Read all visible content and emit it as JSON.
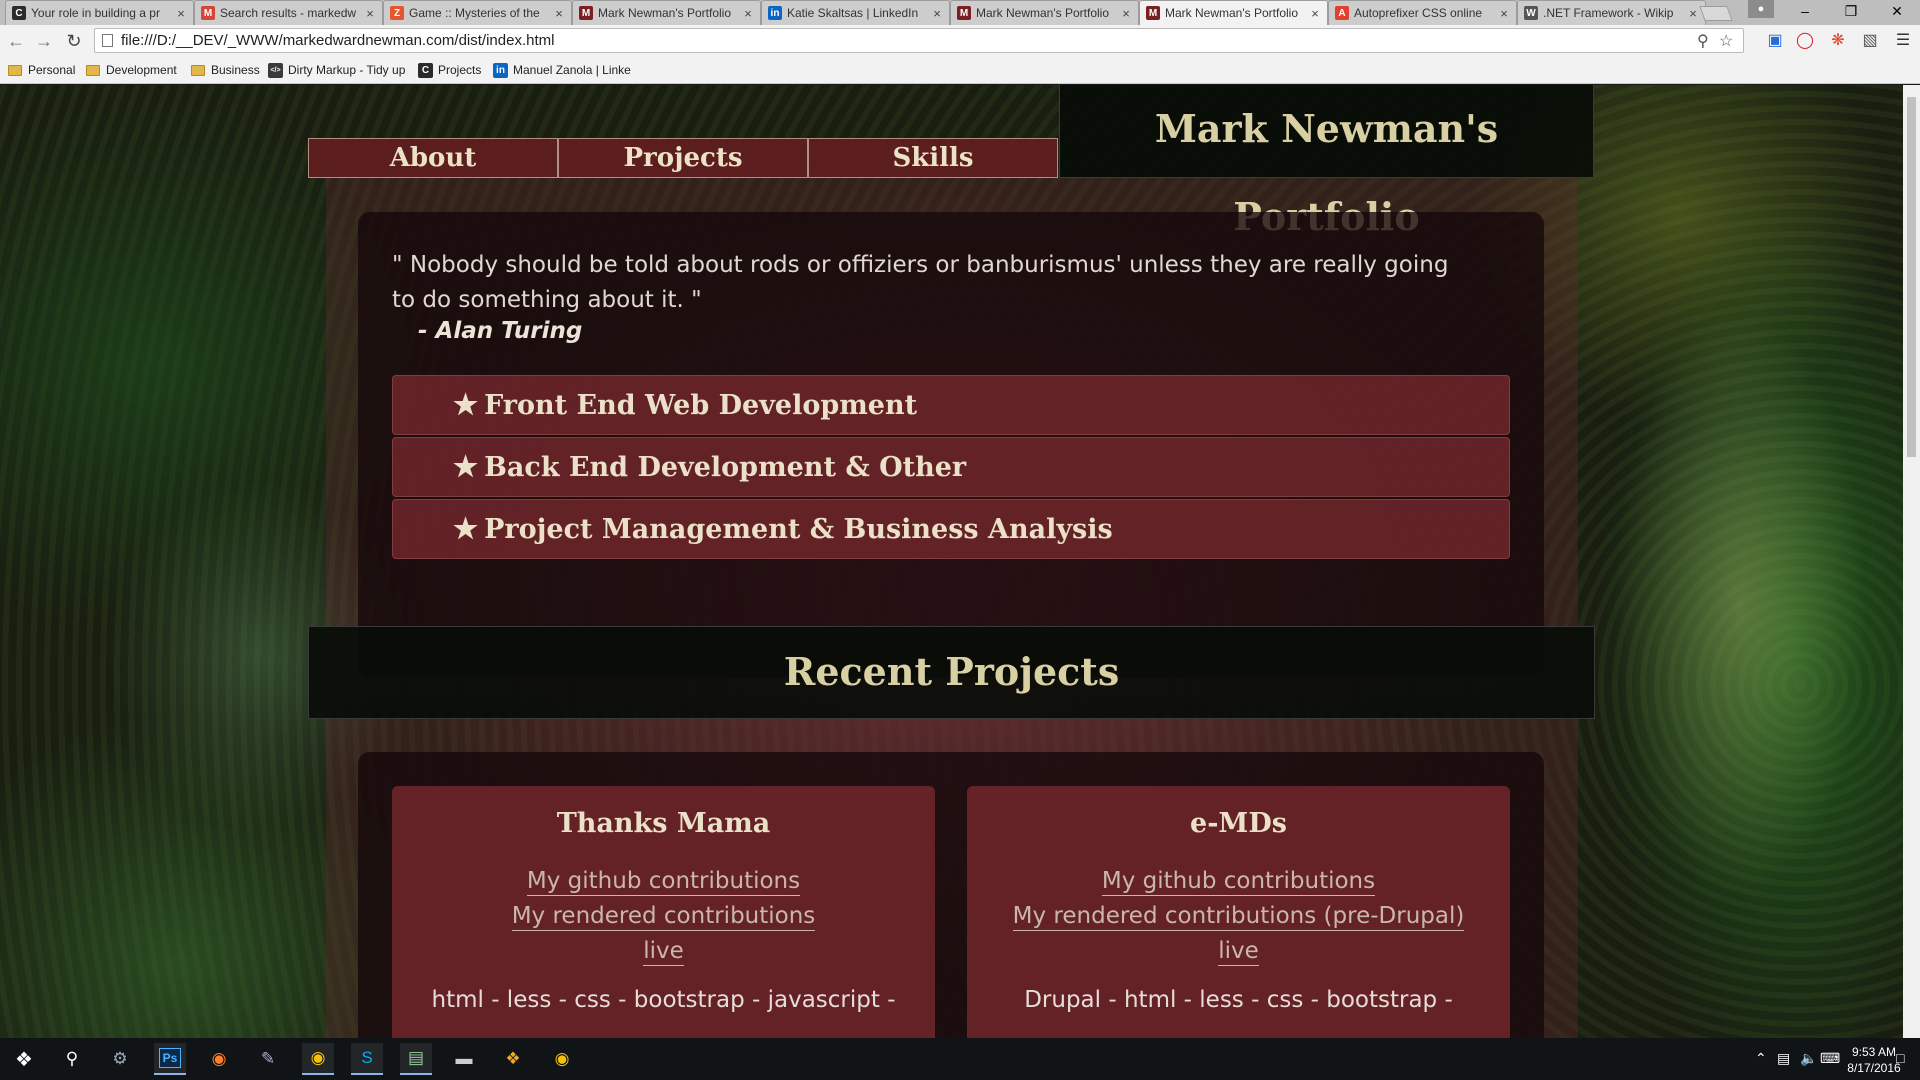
{
  "browser": {
    "tabs": [
      {
        "title": "Your role in building a pr",
        "favicon_letter": "C",
        "favicon_color": "#2b2b2b",
        "active": false
      },
      {
        "title": "Search results - markedw",
        "favicon_letter": "M",
        "favicon_color": "#d44638",
        "active": false
      },
      {
        "title": "Game :: Mysteries of the",
        "favicon_letter": "Z",
        "favicon_color": "#e4572e",
        "active": false
      },
      {
        "title": "Mark Newman's Portfolio",
        "favicon_letter": "M",
        "favicon_color": "#7a1f22",
        "active": false
      },
      {
        "title": "Katie Skaltsas | LinkedIn",
        "favicon_letter": "in",
        "favicon_color": "#0a66c2",
        "active": false
      },
      {
        "title": "Mark Newman's Portfolio",
        "favicon_letter": "M",
        "favicon_color": "#7a1f22",
        "active": false
      },
      {
        "title": "Mark Newman's Portfolio",
        "favicon_letter": "M",
        "favicon_color": "#7a1f22",
        "active": true
      },
      {
        "title": "Autoprefixer CSS online",
        "favicon_letter": "A",
        "favicon_color": "#e0412e",
        "active": false
      },
      {
        "title": ".NET Framework - Wikip",
        "favicon_letter": "W",
        "favicon_color": "#555555",
        "active": false
      }
    ],
    "url": "file:///D:/__DEV/_WWW/markedwardnewman.com/dist/index.html",
    "bookmarks": [
      {
        "label": "Personal",
        "type": "folder"
      },
      {
        "label": "Development",
        "type": "folder"
      },
      {
        "label": "Business",
        "type": "folder"
      },
      {
        "label": "Dirty Markup - Tidy up",
        "type": "site",
        "favicon_letter": "</>",
        "favicon_color": "#3a3a3a"
      },
      {
        "label": "Projects",
        "type": "site",
        "favicon_letter": "C",
        "favicon_color": "#2b2b2b"
      },
      {
        "label": "Manuel Zanola | Linke",
        "type": "site",
        "favicon_letter": "in",
        "favicon_color": "#0a66c2"
      }
    ]
  },
  "site": {
    "title": "Mark Newman's Portfolio",
    "nav": [
      "About",
      "Projects",
      "Skills"
    ],
    "quote": "\" Nobody should be told about rods or offiziers or banburismus' unless they are really going to do something about it. \"",
    "quote_author": "- Alan Turing",
    "skills": [
      "Front End Web Development",
      "Back End Development & Other",
      "Project Management & Business Analysis"
    ],
    "recent_heading": "Recent Projects",
    "projects": [
      {
        "name": "Thanks Mama",
        "links": [
          "My github contributions",
          "My rendered contributions",
          "live"
        ],
        "tech": "html - less - css - bootstrap - javascript -"
      },
      {
        "name": "e-MDs",
        "links": [
          "My github contributions",
          "My rendered contributions (pre-Drupal)",
          "live"
        ],
        "tech": "Drupal - html - less - css - bootstrap -"
      }
    ]
  },
  "taskbar": {
    "apps": [
      "start-icon",
      "search-icon",
      "steam-icon",
      "photoshop-icon",
      "firefox-icon",
      "pen-tablet-icon",
      "chrome-icon",
      "skype-icon",
      "notepad-icon",
      "folder-tray-icon",
      "git-icon",
      "chrome-icon"
    ],
    "photoshop_label": "Ps",
    "time": "9:53 AM",
    "date": "8/17/2016"
  },
  "colors": {
    "accent_maroon": "#6e262a",
    "title_gold": "#d8cfa2",
    "background_green": "#102510"
  }
}
